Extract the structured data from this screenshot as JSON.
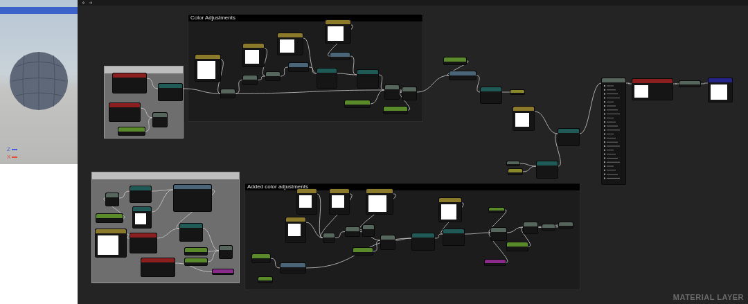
{
  "viewport": {
    "axes": [
      {
        "label": "Z",
        "color": "#4a5ae0"
      },
      {
        "label": "X",
        "color": "#e04a3a"
      }
    ]
  },
  "graph": {
    "comments": [
      {
        "kind": "dark",
        "title": "Color Adjustments"
      },
      {
        "kind": "gray"
      },
      {
        "kind": "gray"
      },
      {
        "kind": "dark",
        "title": "Added color adjustments"
      }
    ],
    "nodes": [
      {
        "color": "#8b1f1f",
        "kind": "plain"
      },
      {
        "color": "#1f5a57",
        "kind": "plain"
      },
      {
        "color": "#8b1f1f",
        "kind": "plain"
      },
      {
        "color": "#56665c",
        "kind": "plain"
      },
      {
        "color": "#5a8a2a",
        "kind": "plain"
      },
      {
        "color": "#8a7a2a",
        "kind": "swatch"
      },
      {
        "color": "#56665c",
        "kind": "plain"
      },
      {
        "color": "#56665c",
        "kind": "plain"
      },
      {
        "color": "#8a7a2a",
        "kind": "swatch"
      },
      {
        "color": "#56665c",
        "kind": "plain"
      },
      {
        "color": "#8a7a2a",
        "kind": "swatch"
      },
      {
        "color": "#4a6578",
        "kind": "plain"
      },
      {
        "color": "#1f5a57",
        "kind": "plain"
      },
      {
        "color": "#8a7a2a",
        "kind": "swatch"
      },
      {
        "color": "#4a6578",
        "kind": "plain"
      },
      {
        "color": "#1f5a57",
        "kind": "plain"
      },
      {
        "color": "#56665c",
        "kind": "plain"
      },
      {
        "color": "#56665c",
        "kind": "plain"
      },
      {
        "color": "#5a8a2a",
        "kind": "plain"
      },
      {
        "color": "#5a8a2a",
        "kind": "plain"
      },
      {
        "color": "#5a8a2a",
        "kind": "plain"
      },
      {
        "color": "#4a6578",
        "kind": "plain"
      },
      {
        "color": "#1f5a57",
        "kind": "plain"
      },
      {
        "color": "#8a8a2a",
        "kind": "plain"
      },
      {
        "color": "#8a7a2a",
        "kind": "swatch"
      },
      {
        "color": "#1f5a57",
        "kind": "plain"
      },
      {
        "color": "#56665c",
        "kind": "plain"
      },
      {
        "color": "#8a8a2a",
        "kind": "plain"
      },
      {
        "color": "#1f5a57",
        "kind": "plain"
      },
      {
        "color": "#56665c",
        "kind": "pins"
      },
      {
        "color": "#8b1f1f",
        "kind": "swatch"
      },
      {
        "color": "#56665c",
        "kind": "plain"
      },
      {
        "color": "#24248a",
        "kind": "swatch"
      },
      {
        "color": "#56665c",
        "kind": "plain"
      },
      {
        "color": "#1f5a57",
        "kind": "plain"
      },
      {
        "color": "#1f5a57",
        "kind": "swatch"
      },
      {
        "color": "#5a8a2a",
        "kind": "plain"
      },
      {
        "color": "#8a7a2a",
        "kind": "swatch"
      },
      {
        "color": "#4a6578",
        "kind": "plain"
      },
      {
        "color": "#8b1f1f",
        "kind": "plain"
      },
      {
        "color": "#1f5a57",
        "kind": "plain"
      },
      {
        "color": "#8b1f1f",
        "kind": "plain"
      },
      {
        "color": "#5a8a2a",
        "kind": "plain"
      },
      {
        "color": "#5a8a2a",
        "kind": "plain"
      },
      {
        "color": "#56665c",
        "kind": "plain"
      },
      {
        "color": "#8a2a8a",
        "kind": "plain"
      },
      {
        "color": "#8a7a2a",
        "kind": "swatch"
      },
      {
        "color": "#8a7a2a",
        "kind": "swatch"
      },
      {
        "color": "#8a7a2a",
        "kind": "swatch"
      },
      {
        "color": "#8a7a2a",
        "kind": "swatch"
      },
      {
        "color": "#56665c",
        "kind": "plain"
      },
      {
        "color": "#56665c",
        "kind": "plain"
      },
      {
        "color": "#56665c",
        "kind": "plain"
      },
      {
        "color": "#56665c",
        "kind": "plain"
      },
      {
        "color": "#5a8a2a",
        "kind": "plain"
      },
      {
        "color": "#1f5a57",
        "kind": "plain"
      },
      {
        "color": "#8a7a2a",
        "kind": "swatch"
      },
      {
        "color": "#1f5a57",
        "kind": "plain"
      },
      {
        "color": "#5a8a2a",
        "kind": "plain"
      },
      {
        "color": "#56665c",
        "kind": "plain"
      },
      {
        "color": "#56665c",
        "kind": "plain"
      },
      {
        "color": "#56665c",
        "kind": "plain"
      },
      {
        "color": "#56665c",
        "kind": "plain"
      },
      {
        "color": "#5a8a2a",
        "kind": "plain"
      },
      {
        "color": "#8a2a8a",
        "kind": "plain"
      },
      {
        "color": "#5a8a2a",
        "kind": "plain"
      },
      {
        "color": "#4a6578",
        "kind": "plain"
      },
      {
        "color": "#5a8a2a",
        "kind": "plain"
      }
    ],
    "label": "MATERIAL LAYER"
  }
}
